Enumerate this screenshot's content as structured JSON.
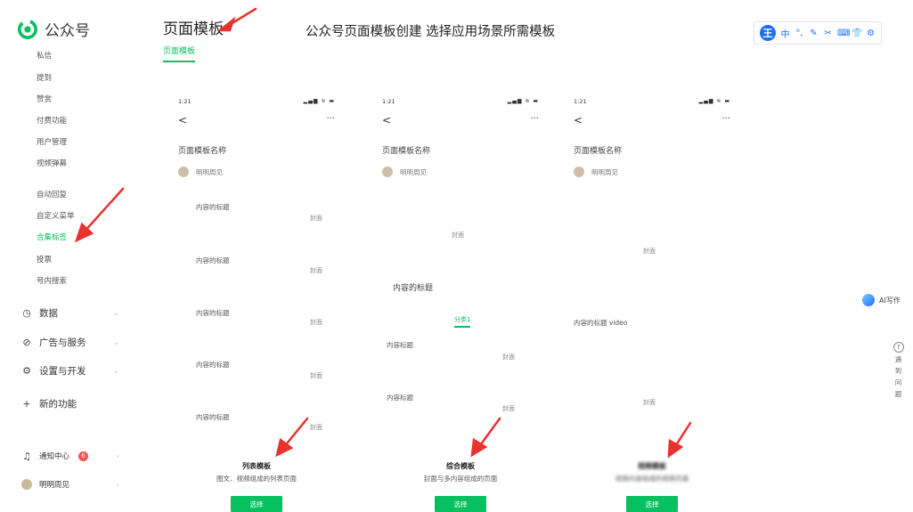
{
  "brand": {
    "name": "公众号",
    "color": "#07c160"
  },
  "sidebar": {
    "sub_items": [
      {
        "label": "私信",
        "active": false
      },
      {
        "label": "提到",
        "active": false
      },
      {
        "label": "赞赏",
        "active": false
      },
      {
        "label": "付费功能",
        "active": false
      },
      {
        "label": "用户管理",
        "active": false
      },
      {
        "label": "视频弹幕",
        "active": false
      },
      {
        "label": "自动回复",
        "active": false
      },
      {
        "label": "自定义菜单",
        "active": false
      },
      {
        "label": "合集标签",
        "active": true
      },
      {
        "label": "投票",
        "active": false
      },
      {
        "label": "号内搜索",
        "active": false
      }
    ],
    "groups": [
      {
        "label": "数据",
        "icon": "clock-icon"
      },
      {
        "label": "广告与服务",
        "icon": "compass-icon"
      },
      {
        "label": "设置与开发",
        "icon": "gear-icon"
      },
      {
        "label": "新的功能",
        "icon": "plus-icon"
      }
    ],
    "notification": {
      "label": "通知中心",
      "count": "6"
    },
    "account": {
      "label": "明明周见"
    }
  },
  "header": {
    "title": "页面模板",
    "tab": "页面模板",
    "caption": "公众号页面模板创建 选择应用场景所需模板"
  },
  "toolbar": {
    "logo": "王",
    "icons": [
      "中",
      "°,",
      "✎",
      "✂",
      "⌨",
      "👕",
      "⚙"
    ]
  },
  "phone": {
    "time": "1:21",
    "back": "<",
    "more": "···"
  },
  "templates": [
    {
      "template_name": "页面模板名称",
      "author": "明明周见",
      "content": [
        {
          "text": "内容的标题",
          "cover": "封面"
        },
        {
          "text": "内容的标题",
          "cover": "封面"
        },
        {
          "text": "内容的标题",
          "cover": "封面"
        },
        {
          "text": "内容的标题",
          "cover": "封面"
        },
        {
          "text": "内容的标题",
          "cover": "封面"
        }
      ],
      "name": "列表模板",
      "desc": "图文、视频组成的列表页面",
      "button": "选择"
    },
    {
      "template_name": "页面模板名称",
      "author": "明明周见",
      "banner_cover": "封面",
      "mid_title": "内容的标题",
      "category": "分类1",
      "content": [
        {
          "text": "内容标题",
          "cover": "封面"
        },
        {
          "text": "内容标题",
          "cover": "封面"
        }
      ],
      "name": "综合模板",
      "desc": "封面与多内容组成的页面",
      "button": "选择"
    },
    {
      "template_name": "页面模板名称",
      "author": "明明周见",
      "top_cover": "封面",
      "video_title": "内容的标题 video",
      "bottom_cover": "封面",
      "name": "视频模板",
      "desc": "视频内容组成的视频页面",
      "button": "选择"
    }
  ],
  "widgets": {
    "ai_write": "AI写作",
    "help_chars": [
      "遇",
      "到",
      "问",
      "题"
    ],
    "help_icon": "?"
  }
}
